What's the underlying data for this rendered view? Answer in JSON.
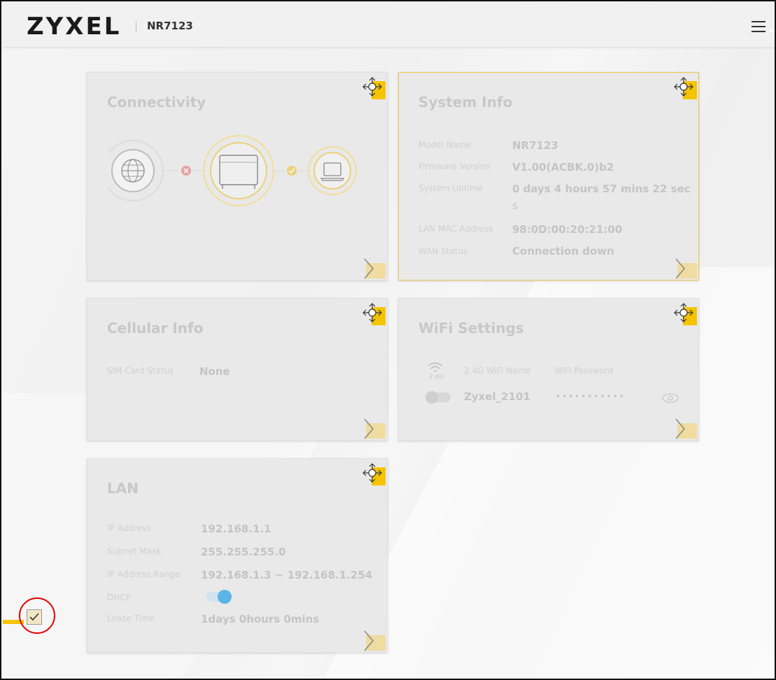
{
  "header": {
    "logo": "ZYXEL",
    "model": "NR7123"
  },
  "cards": {
    "connectivity": {
      "title": "Connectivity"
    },
    "system_info": {
      "title": "System Info",
      "rows": [
        {
          "label": "Model Name",
          "value": "NR7123"
        },
        {
          "label": "Firmware Version",
          "value": "V1.00(ACBK.0)b2"
        },
        {
          "label": "System Uptime",
          "value": "0 days 4 hours 57 mins 22 sec",
          "value_cont": "s"
        },
        {
          "label": "LAN MAC Address",
          "value": "98:0D:00:20:21:00"
        },
        {
          "label": "WAN Status",
          "value": "Connection down"
        }
      ]
    },
    "cellular_info": {
      "title": "Cellular Info",
      "rows": [
        {
          "label": "SIM Card Status",
          "value": "None"
        }
      ]
    },
    "wifi_settings": {
      "title": "WiFi Settings",
      "band": "2.4G",
      "name_header": "2.4G WiFi Name",
      "password_header": "WiFi Password",
      "ssid": "Zyxel_2101",
      "password_masked": "•••••••••••"
    },
    "lan": {
      "title": "LAN",
      "rows": [
        {
          "label": "IP Address",
          "value": "192.168.1.1"
        },
        {
          "label": "Subnet Mask",
          "value": "255.255.255.0"
        },
        {
          "label": "IP Address Range",
          "value": "192.168.1.3 ~ 192.168.1.254"
        },
        {
          "label": "DHCP",
          "value": ""
        },
        {
          "label": "Lease Time",
          "value": "1days 0hours 0mins"
        }
      ],
      "dhcp_enabled": true
    }
  },
  "colors": {
    "accent": "#f5c400",
    "selected_border": "#f0c64a",
    "toggle_on": "#5ab4e6",
    "error": "#e00000"
  }
}
